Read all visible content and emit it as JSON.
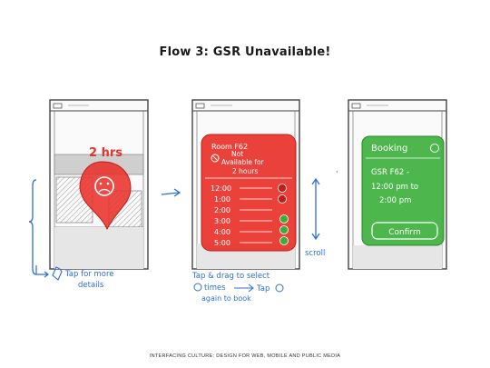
{
  "title": "Flow 3: GSR Unavailable!",
  "footer": "INTERFACING CULTURE: DESIGN FOR WEB, MOBILE AND PUBLIC MEDIA",
  "screen1": {
    "badge": "2 hrs",
    "annotation_line1": "Tap for more",
    "annotation_line2": "details"
  },
  "screen2": {
    "heading_line1": "Room F62",
    "heading_line2": "Not",
    "heading_line3": "Available for",
    "heading_line4": "2 hours",
    "times": [
      "12:00",
      "1:00",
      "2:00",
      "3:00",
      "4:00",
      "5:00"
    ],
    "scroll_label": "scroll",
    "annotation_line1": "Tap & drag to select",
    "annotation_line2": "times",
    "annotation_arrow_text": "Tap",
    "annotation_line3": "again to book"
  },
  "screen3": {
    "heading": "Booking",
    "line1": "GSR F62 -",
    "line2": "12:00 pm to",
    "line3": "2:00 pm",
    "confirm": "Confirm"
  },
  "colors": {
    "red": "#e8322a",
    "green": "#3aae3a",
    "ink": "#2b6fd6"
  }
}
